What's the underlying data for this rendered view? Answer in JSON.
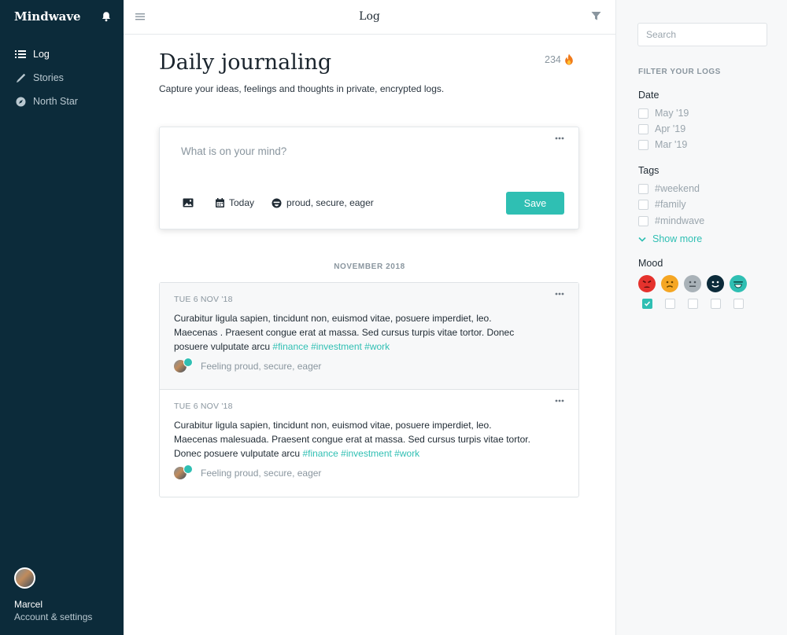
{
  "app": {
    "brand": "Mindwave"
  },
  "sidebar": {
    "nav": [
      {
        "label": "Log",
        "icon": "list-icon",
        "active": true
      },
      {
        "label": "Stories",
        "icon": "pen-icon",
        "active": false
      },
      {
        "label": "North Star",
        "icon": "compass-icon",
        "active": false
      }
    ],
    "account": {
      "name": "Marcel",
      "settings_label": "Account & settings"
    }
  },
  "topbar": {
    "title": "Log"
  },
  "page": {
    "title": "Daily journaling",
    "subtitle": "Capture your ideas, feelings and thoughts in private, encrypted logs.",
    "streak": "234"
  },
  "composer": {
    "placeholder": "What is on your mind?",
    "date_label": "Today",
    "mood_label": "proud, secure, eager",
    "save_label": "Save"
  },
  "feed": {
    "month": "NOVEMBER 2018",
    "entries": [
      {
        "date": "TUE 6 NOV '18",
        "text": "Curabitur ligula sapien, tincidunt non, euismod vitae, posuere imperdiet, leo. Maecenas  . Praesent congue erat at massa. Sed cursus turpis vitae tortor. Donec posuere vulputate arcu ",
        "tags": "#finance #investment #work",
        "feeling": "Feeling proud, secure, eager"
      },
      {
        "date": "TUE 6 NOV '18",
        "text": "Curabitur ligula sapien, tincidunt non, euismod vitae, posuere imperdiet, leo. Maecenas malesuada. Praesent congue erat at massa. Sed cursus turpis vitae tortor. Donec posuere vulputate arcu ",
        "tags": "#finance #investment #work",
        "feeling": "Feeling proud, secure, eager"
      }
    ]
  },
  "filters": {
    "search_placeholder": "Search",
    "heading": "FILTER YOUR LOGS",
    "date": {
      "label": "Date",
      "options": [
        "May '19",
        "Apr '19",
        "Mar '19"
      ]
    },
    "tags": {
      "label": "Tags",
      "options": [
        "#weekend",
        "#family",
        "#mindwave"
      ],
      "show_more": "Show more"
    },
    "mood": {
      "label": "Mood",
      "options": [
        {
          "name": "angry",
          "color": "#e5322d",
          "checked": true
        },
        {
          "name": "sad",
          "color": "#f5a623",
          "checked": false
        },
        {
          "name": "neutral",
          "color": "#a9b2b8",
          "checked": false
        },
        {
          "name": "happy",
          "color": "#0c2b3a",
          "checked": false
        },
        {
          "name": "joyful",
          "color": "#2fbfb3",
          "checked": false
        }
      ]
    }
  },
  "colors": {
    "accent": "#2fbfb3",
    "sidebar_bg": "#0c2b3a"
  }
}
